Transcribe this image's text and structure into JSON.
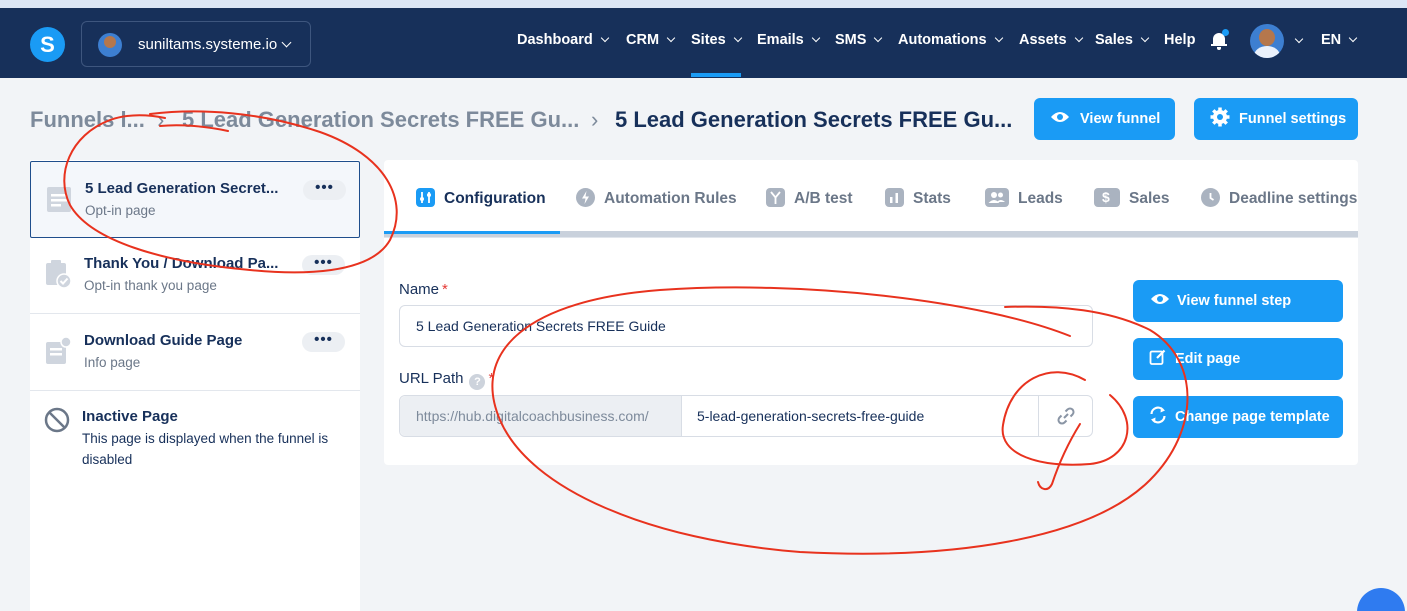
{
  "colors": {
    "nav_bg": "#17305a",
    "accent": "#1a9bf5",
    "annotation": "#e8321e"
  },
  "topbar": {
    "logo_letter": "S",
    "workspace": "suniltams.systeme.io",
    "nav": [
      {
        "label": "Dashboard",
        "dropdown": true
      },
      {
        "label": "CRM",
        "dropdown": true
      },
      {
        "label": "Sites",
        "dropdown": true,
        "active": true
      },
      {
        "label": "Emails",
        "dropdown": true
      },
      {
        "label": "SMS",
        "dropdown": true
      },
      {
        "label": "Automations",
        "dropdown": true
      },
      {
        "label": "Assets",
        "dropdown": true
      },
      {
        "label": "Sales",
        "dropdown": true
      },
      {
        "label": "Help",
        "dropdown": false
      }
    ],
    "language": "EN",
    "icons": [
      "bell-icon",
      "user-avatar"
    ]
  },
  "breadcrumb": {
    "items": [
      "Funnels l...",
      "5 Lead Generation Secrets FREE Gu...",
      "5 Lead Generation Secrets FREE Gu..."
    ]
  },
  "header_buttons": {
    "view_funnel": "View funnel",
    "funnel_settings": "Funnel settings"
  },
  "sidebar": {
    "steps": [
      {
        "title": "5 Lead Generation Secret...",
        "subtitle": "Opt-in page",
        "active": true,
        "more": "•••"
      },
      {
        "title": "Thank You / Download Pa...",
        "subtitle": "Opt-in thank you page",
        "active": false,
        "more": "•••"
      },
      {
        "title": "Download Guide Page",
        "subtitle": "Info page",
        "active": false,
        "more": "•••"
      }
    ],
    "inactive": {
      "title": "Inactive Page",
      "description_line1": "This page is displayed when the funnel is",
      "description_line2": "disabled"
    }
  },
  "tabs": [
    {
      "label": "Configuration",
      "active": true,
      "icon": "configuration-icon"
    },
    {
      "label": "Automation Rules",
      "active": false,
      "icon": "bolt-icon"
    },
    {
      "label": "A/B test",
      "active": false,
      "icon": "split-icon"
    },
    {
      "label": "Stats",
      "active": false,
      "icon": "stats-icon"
    },
    {
      "label": "Leads",
      "active": false,
      "icon": "users-icon"
    },
    {
      "label": "Sales",
      "active": false,
      "icon": "dollar-icon"
    },
    {
      "label": "Deadline settings",
      "active": false,
      "icon": "clock-icon"
    }
  ],
  "form": {
    "name_label": "Name",
    "name_value": "5 Lead Generation Secrets FREE Guide",
    "url_label": "URL Path",
    "url_help": "?",
    "url_prefix": "https://hub.digitalcoachbusiness.com/",
    "url_path": "5-lead-generation-secrets-free-guide",
    "required_mark": "*"
  },
  "actions": {
    "view_step": "View funnel step",
    "edit_page": "Edit page",
    "change_template": "Change page template"
  }
}
